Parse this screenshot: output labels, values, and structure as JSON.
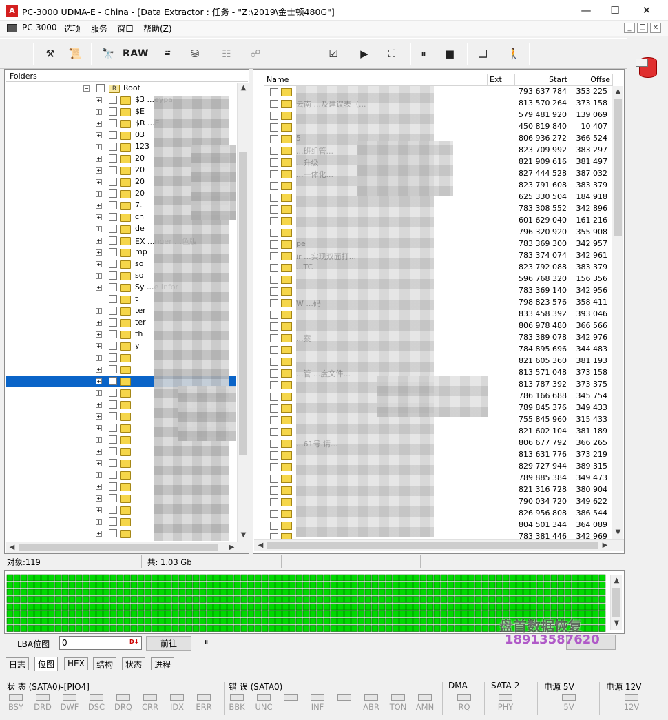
{
  "window": {
    "title": "PC-3000 UDMA-E - China - [Data Extractor : 任务 - \"Z:\\2019\\金士顿480G\"]",
    "logo_text": "A",
    "minimize": "—",
    "maximize": "☐",
    "close": "✕"
  },
  "menu": {
    "items": [
      "PC-3000",
      "选项",
      "服务",
      "窗口",
      "帮助(Z)"
    ],
    "mdi_min": "_",
    "mdi_restore": "❐",
    "mdi_close": "✕"
  },
  "toolbar": {
    "raw_label": "RAW"
  },
  "folders": {
    "header": "Folders",
    "root": "Root",
    "root_icon": "R",
    "items": [
      "$3 ...eypa",
      "$E",
      "$R ...E",
      "03",
      "123",
      "20",
      "20",
      "20",
      "20",
      "7.",
      "ch",
      "de",
      "EX ...nger ...色版",
      "mp",
      "so",
      "so",
      "Sy ...e Infor",
      "t",
      "ter",
      "ter",
      "th",
      "y",
      "",
      "",
      "",
      "",
      "",
      "",
      "",
      "",
      "",
      "",
      "",
      "",
      "",
      "",
      "",
      "",
      "",
      ""
    ],
    "selected_index": 24
  },
  "files": {
    "columns": [
      "Name",
      "Ext",
      "Start",
      "Offse"
    ],
    "rows": [
      {
        "name": "",
        "start": "793 637 784",
        "offset": "353 225"
      },
      {
        "name": "云南 ...及建议表（...",
        "start": "813 570 264",
        "offset": "373 158"
      },
      {
        "name": "",
        "start": "579 481 920",
        "offset": "139 069"
      },
      {
        "name": "",
        "start": "450 819 840",
        "offset": "10 407"
      },
      {
        "name": "5",
        "start": "806 936 272",
        "offset": "366 524"
      },
      {
        "name": "...班组管...",
        "start": "823 709 992",
        "offset": "383 297"
      },
      {
        "name": "...升级",
        "start": "821 909 616",
        "offset": "381 497"
      },
      {
        "name": "...一体化...",
        "start": "827 444 528",
        "offset": "387 032"
      },
      {
        "name": "",
        "start": "823 791 608",
        "offset": "383 379"
      },
      {
        "name": "",
        "start": "625 330 504",
        "offset": "184 918"
      },
      {
        "name": "",
        "start": "783 308 552",
        "offset": "342 896"
      },
      {
        "name": "",
        "start": "601 629 040",
        "offset": "161 216"
      },
      {
        "name": "",
        "start": "796 320 920",
        "offset": "355 908"
      },
      {
        "name": "pe",
        "start": "783 369 300",
        "offset": "342 957"
      },
      {
        "name": "ir ...实现双面打...",
        "start": "783 374 074",
        "offset": "342 961"
      },
      {
        "name": "...TC",
        "start": "823 792 088",
        "offset": "383 379"
      },
      {
        "name": "",
        "start": "596 768 320",
        "offset": "156 356"
      },
      {
        "name": "",
        "start": "783 369 140",
        "offset": "342 956"
      },
      {
        "name": "W ...码",
        "start": "798 823 576",
        "offset": "358 411"
      },
      {
        "name": "",
        "start": "833 458 392",
        "offset": "393 046"
      },
      {
        "name": "",
        "start": "806 978 480",
        "offset": "366 566"
      },
      {
        "name": "...案",
        "start": "783 389 078",
        "offset": "342 976"
      },
      {
        "name": "",
        "start": "784 895 696",
        "offset": "344 483"
      },
      {
        "name": "",
        "start": "821 605 360",
        "offset": "381 193"
      },
      {
        "name": "...管 ...度文件...",
        "start": "813 571 048",
        "offset": "373 158"
      },
      {
        "name": "",
        "start": "813 787 392",
        "offset": "373 375"
      },
      {
        "name": "",
        "start": "786 166 688",
        "offset": "345 754"
      },
      {
        "name": "",
        "start": "789 845 376",
        "offset": "349 433"
      },
      {
        "name": "",
        "start": "755 845 960",
        "offset": "315 433"
      },
      {
        "name": "",
        "start": "821 602 104",
        "offset": "381 189"
      },
      {
        "name": "...61号.请...",
        "start": "806 677 792",
        "offset": "366 265"
      },
      {
        "name": "",
        "start": "813 631 776",
        "offset": "373 219"
      },
      {
        "name": "",
        "start": "829 727 944",
        "offset": "389 315"
      },
      {
        "name": "",
        "start": "789 885 384",
        "offset": "349 473"
      },
      {
        "name": "",
        "start": "821 316 728",
        "offset": "380 904"
      },
      {
        "name": "",
        "start": "790 034 720",
        "offset": "349 622"
      },
      {
        "name": "",
        "start": "826 956 808",
        "offset": "386 544"
      },
      {
        "name": "",
        "start": "804 501 344",
        "offset": "364 089"
      },
      {
        "name": "",
        "start": "783 381 446",
        "offset": "342 969"
      }
    ]
  },
  "status": {
    "objects": "对象:119",
    "total": "共:  1.03 Gb"
  },
  "bottom": {
    "lba_label": "LBA位图",
    "lba_value": "0",
    "lba_icon": "D⬇",
    "forward_button": "前往",
    "pause": "⏸",
    "watermark_line1": "盘首数据恢复",
    "watermark_line2": "18913587620",
    "tabs": [
      "日志",
      "位图",
      "HEX",
      "结构",
      "状态",
      "进程"
    ],
    "active_tab": 1
  },
  "indicators": {
    "status_label": "状 态 (SATA0)-[PIO4]",
    "error_label": "错 误 (SATA0)",
    "dma_label": "DMA",
    "sata_label": "SATA-2",
    "power5_label": "电源 5V",
    "power12_label": "电源 12V",
    "status_leds": [
      "BSY",
      "DRD",
      "DWF",
      "DSC",
      "DRQ",
      "CRR",
      "IDX",
      "ERR"
    ],
    "error_leds": [
      "BBK",
      "UNC",
      "",
      "INF",
      "",
      "ABR",
      "TON",
      "AMN"
    ],
    "dma_led": "RQ",
    "sata_led": "PHY",
    "p5_led": "5V",
    "p12_led": "12V"
  },
  "colors": {
    "selection": "#0a64c8",
    "map_cell": "#00d800",
    "map_border": "#006400"
  }
}
